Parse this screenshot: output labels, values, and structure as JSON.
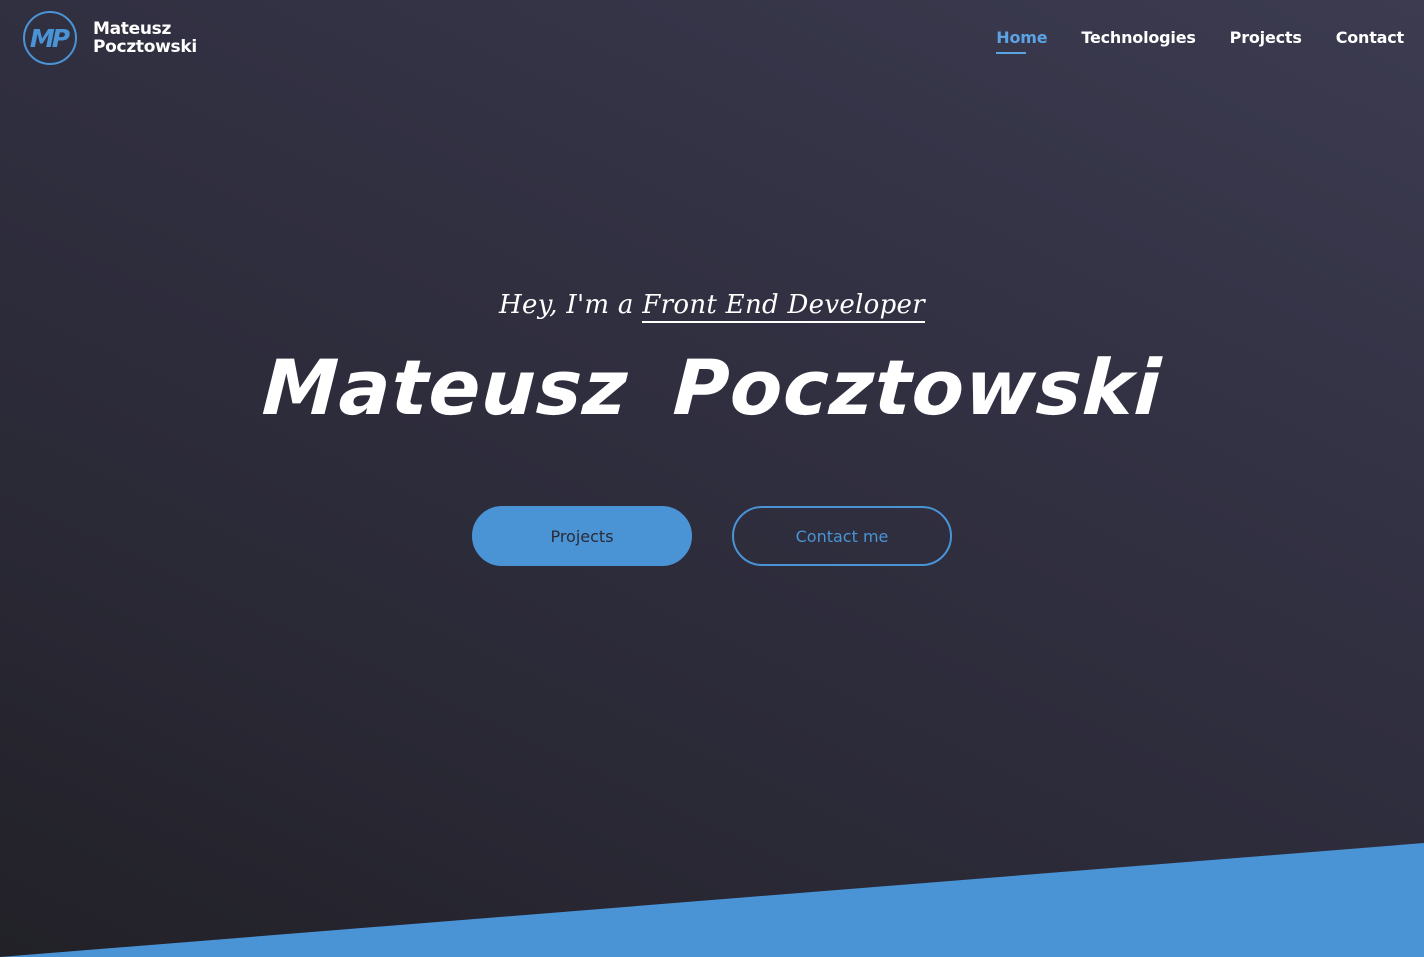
{
  "header": {
    "logo_initials": "MP",
    "logo_first_name": "Mateusz",
    "logo_last_name": "Pocztowski",
    "nav": [
      {
        "label": "Home",
        "active": true
      },
      {
        "label": "Technologies",
        "active": false
      },
      {
        "label": "Projects",
        "active": false
      },
      {
        "label": "Contact",
        "active": false
      }
    ]
  },
  "hero": {
    "subtitle_prefix": "Hey, I'm a",
    "subtitle_role": "Front End Developer",
    "title": "Mateusz Pocztowski",
    "primary_button": "Projects",
    "secondary_button": "Contact me"
  },
  "colors": {
    "accent": "#4a94d6",
    "nav_active": "#5ba3e4",
    "background": "#2f2e3d",
    "text": "#ffffff"
  }
}
